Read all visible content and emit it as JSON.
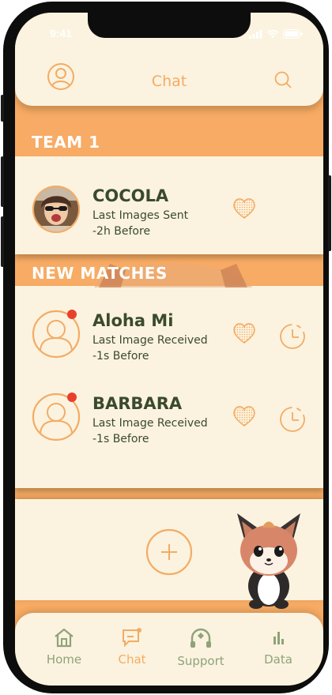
{
  "status_bar": {
    "time": "9:41"
  },
  "header": {
    "title": "Chat",
    "left_icon": "profile-icon",
    "right_icon": "search-icon"
  },
  "sections": [
    {
      "title": "TEAM 1",
      "items": [
        {
          "name": "COCOLA",
          "line1": "Last Images Sent",
          "line2": "-2h Before",
          "avatar": "photo",
          "actions": [
            "heart-icon"
          ]
        }
      ]
    },
    {
      "title": "NEW MATCHES",
      "items": [
        {
          "name": "Aloha Mi",
          "line1": "Last Image Received",
          "line2": "-1s Before",
          "avatar": "person-outline",
          "unread": true,
          "actions": [
            "heart-icon",
            "clock-icon"
          ]
        },
        {
          "name": "BARBARA",
          "line1": "Last Image Received",
          "line2": "-1s Before",
          "avatar": "person-outline",
          "unread": true,
          "actions": [
            "heart-icon",
            "clock-icon"
          ]
        }
      ]
    }
  ],
  "add_button": {
    "icon": "plus-icon"
  },
  "bottom_nav": [
    {
      "label": "Home",
      "icon": "home-icon",
      "active": false
    },
    {
      "label": "Chat",
      "icon": "chat-icon",
      "active": true
    },
    {
      "label": "Support",
      "icon": "support-icon",
      "active": false
    },
    {
      "label": "Data",
      "icon": "bar-chart-icon",
      "active": false
    }
  ],
  "colors": {
    "accent": "#f4ab64",
    "background": "#fbf3df",
    "text_dark": "#3b4a2c",
    "nav_inactive": "#8ea37a",
    "notification": "#e8402c"
  }
}
